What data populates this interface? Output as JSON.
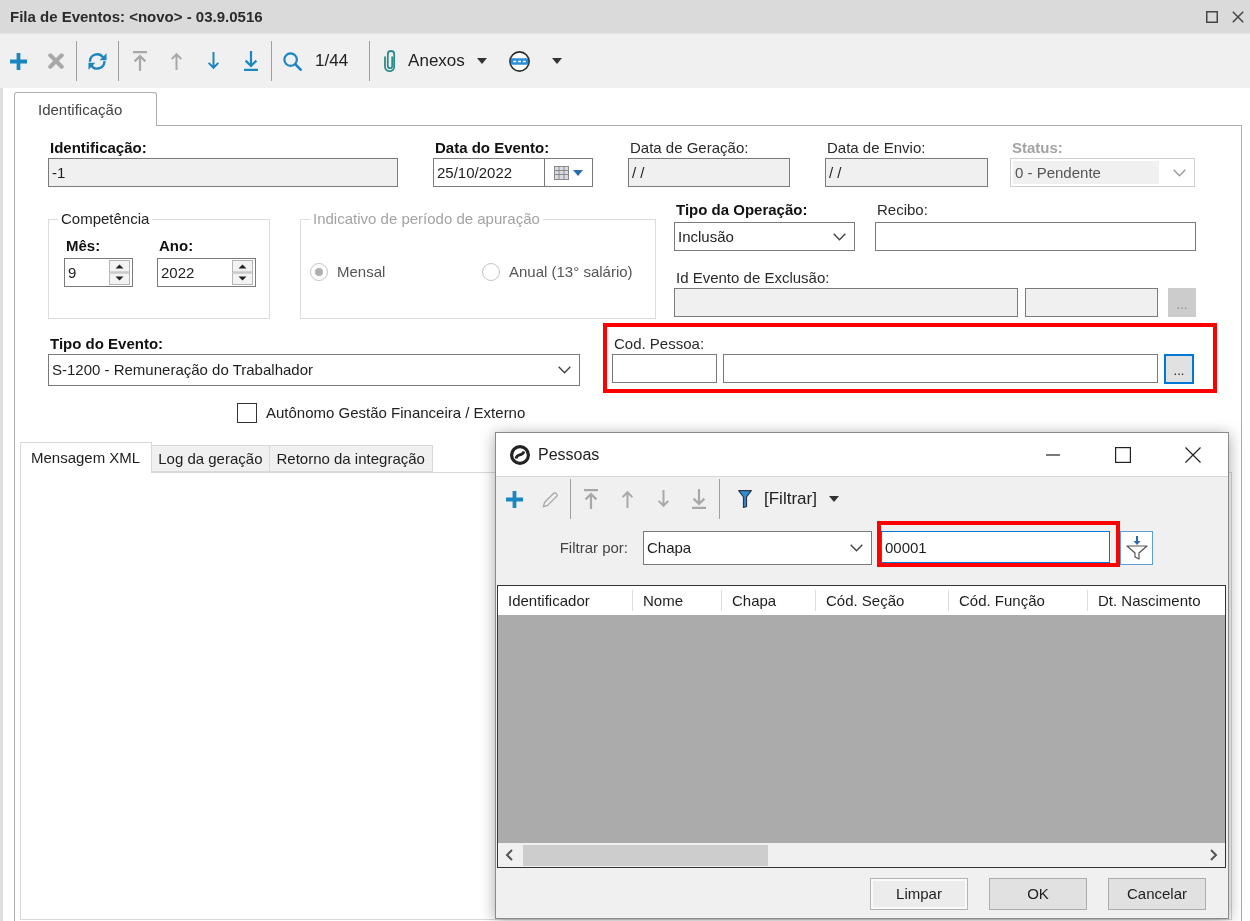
{
  "window": {
    "title": "Fila de Eventos: <novo> - 03.9.0516"
  },
  "toolbar": {
    "groups": [
      {
        "buttons": [
          {
            "disabled": false
          },
          {
            "disabled": true
          }
        ]
      },
      {
        "buttons": [
          {
            "disabled": false
          }
        ]
      },
      {
        "buttons": [
          {
            "disabled": true
          },
          {
            "disabled": true
          },
          {
            "disabled": false
          },
          {
            "disabled": false
          }
        ]
      },
      {
        "buttons": [
          {
            "disabled": false
          }
        ],
        "counter": "1/44"
      },
      {
        "buttons": [
          {
            "label": "Anexos",
            "dropdown": true
          },
          {
            "dropdown": true
          }
        ]
      }
    ]
  },
  "tabs": [
    {
      "label": "Identificação",
      "selected": true
    }
  ],
  "form": {
    "identificacao": {
      "label": "Identificação:",
      "required": true,
      "value": "-1",
      "readonly": true
    },
    "data_do_evento": {
      "label": "Data do Evento:",
      "required": true,
      "value": "25/10/2022"
    },
    "data_de_geracao": {
      "label": "Data de Geração:",
      "required": false,
      "value": "/ /",
      "readonly": true
    },
    "data_de_envio": {
      "label": "Data de Envio:",
      "required": false,
      "value": "/ /",
      "readonly": true
    },
    "status": {
      "label": "Status:",
      "required": true,
      "value": "0 - Pendente",
      "disabled": true
    },
    "competencia": {
      "legend": "Competência",
      "mes": {
        "label": "Mês:",
        "required": true,
        "value": "9"
      },
      "ano": {
        "label": "Ano:",
        "required": true,
        "value": "2022"
      }
    },
    "indicativo": {
      "legend": "Indicativo de período de apuração",
      "disabled": true,
      "options": [
        {
          "label": "Mensal",
          "selected": true
        },
        {
          "label": "Anual (13° salário)",
          "selected": false
        }
      ]
    },
    "tipo_da_operacao": {
      "label": "Tipo da Operação:",
      "required": true,
      "value": "Inclusão"
    },
    "recibo": {
      "label": "Recibo:",
      "required": false
    },
    "id_evento_de_exclusao": {
      "label": "Id Evento de Exclusão:",
      "required": false,
      "readonly": true,
      "button": {
        "label": "...",
        "disabled": true
      }
    },
    "tipo_do_evento": {
      "label": "Tipo do Evento:",
      "required": true,
      "value": "S-1200 - Remuneração do Trabalhador"
    },
    "cod_pessoa": {
      "label": "Cod. Pessoa:",
      "required": false,
      "highlighted": true,
      "button": {
        "label": "...",
        "focused": true
      }
    },
    "autonomo": {
      "label": "Autônomo Gestão Financeira / Externo",
      "checked": false
    }
  },
  "lower_tabs": [
    {
      "label": "Mensagem XML",
      "selected": true
    },
    {
      "label": "Log da geração",
      "selected": false
    },
    {
      "label": "Retorno da integração",
      "selected": false
    }
  ],
  "dialog": {
    "title": "Pessoas",
    "toolbar": {
      "groups": [
        {
          "buttons": [
            {
              "disabled": false
            },
            {
              "disabled": true
            }
          ]
        },
        {
          "buttons": [
            {
              "disabled": true
            },
            {
              "disabled": true
            },
            {
              "disabled": true
            },
            {
              "disabled": true
            }
          ]
        },
        {
          "buttons": [
            {
              "label": "[Filtrar]",
              "dropdown": true
            }
          ]
        }
      ]
    },
    "filter": {
      "label": "Filtrar por:",
      "field": "Chapa",
      "value": "00001",
      "focused": true,
      "highlighted": true
    },
    "table": {
      "columns": [
        "Identificador",
        "Nome",
        "Chapa",
        "Cód. Seção",
        "Cód. Função",
        "Dt. Nascimento"
      ]
    },
    "buttons": [
      {
        "label": "Limpar",
        "focused": true
      },
      {
        "label": "OK",
        "focused": false
      },
      {
        "label": "Cancelar",
        "focused": false
      }
    ]
  }
}
